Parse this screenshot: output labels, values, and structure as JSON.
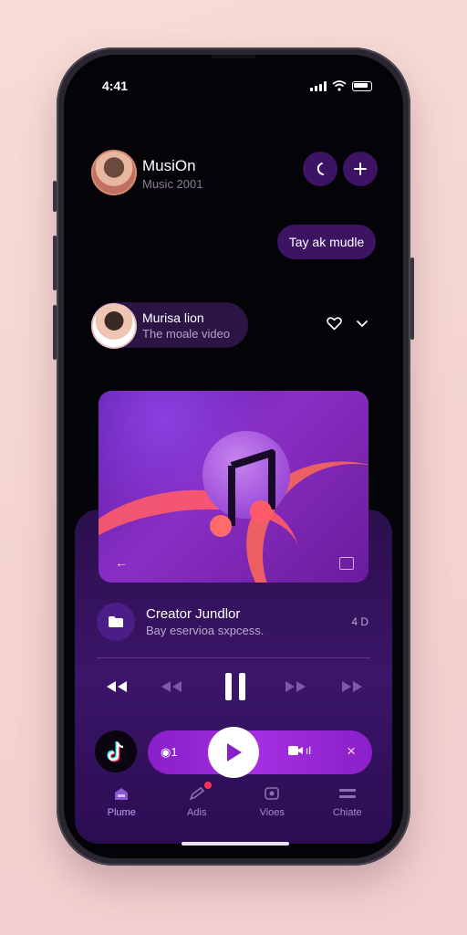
{
  "status": {
    "time": "4:41"
  },
  "header": {
    "title": "MusiOn",
    "subtitle": "Music 2001"
  },
  "actions": {
    "call_icon": "phone-icon",
    "add_icon": "plus-icon"
  },
  "chip": {
    "label": "Tay ak mudle"
  },
  "profile_card": {
    "name": "Murisa lion",
    "caption": "The moale video"
  },
  "hero": {
    "icon": "music-note-icon"
  },
  "creator": {
    "title": "Creator Jundlor",
    "subtitle": "Bay eservioa sxpcess.",
    "side": "4 D"
  },
  "player": {
    "left_label": "1",
    "right_label": "ıl",
    "close": "×"
  },
  "nav": [
    {
      "label": "Plume",
      "icon": "home-icon"
    },
    {
      "label": "Adis",
      "icon": "pen-icon",
      "badge": true
    },
    {
      "label": "Vioes",
      "icon": "video-icon"
    },
    {
      "label": "Chiate",
      "icon": "chat-icon"
    }
  ],
  "colors": {
    "accent": "#a32fe0",
    "panel": "#3b1569",
    "pill": "#3d1463",
    "background": "#040308"
  }
}
